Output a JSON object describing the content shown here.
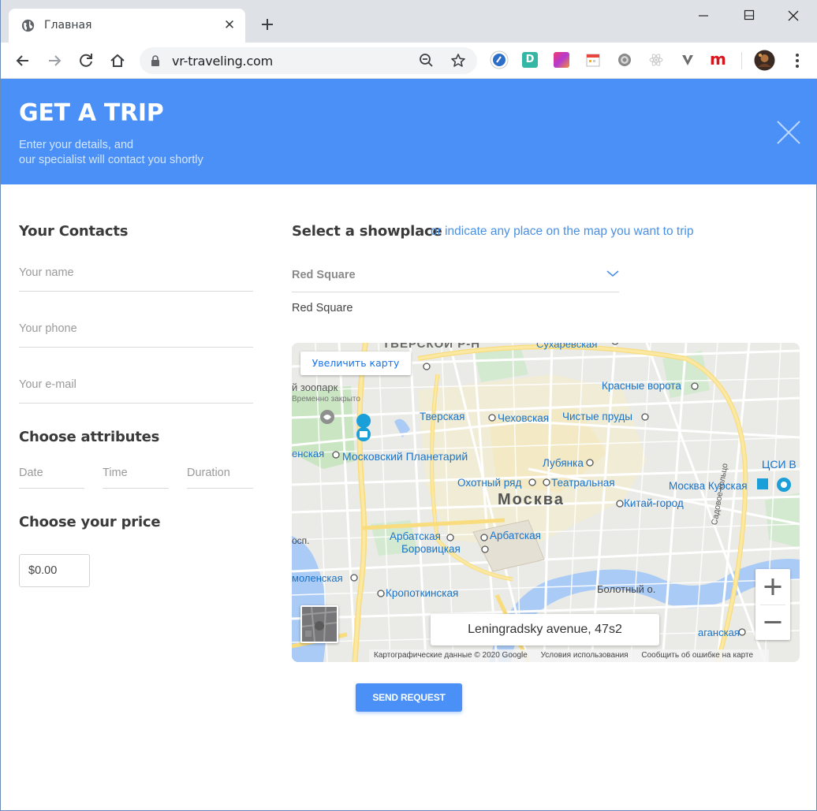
{
  "browser": {
    "tab_title": "Главная",
    "url": "vr-traveling.com",
    "extensions": [
      "blue-circle-extension",
      "d-extension",
      "gradient-extension",
      "calendar-extension",
      "gear-extension",
      "react-extension",
      "v-extension",
      "m-extension"
    ]
  },
  "header": {
    "title": "GET A TRIP",
    "subtitle_line1": "Enter your details, and",
    "subtitle_line2": "our specialist will contact you shortly",
    "bg_color": "#4a90f7"
  },
  "contacts": {
    "heading": "Your Contacts",
    "name_placeholder": "Your name",
    "phone_placeholder": "Your phone",
    "email_placeholder": "Your e-mail"
  },
  "attributes": {
    "heading": "Choose attributes",
    "date_placeholder": "Date",
    "time_placeholder": "Time",
    "duration_placeholder": "Duration"
  },
  "price": {
    "heading": "Choose your price",
    "value": "$0.00"
  },
  "showplace": {
    "heading": "Select a showplace",
    "link_text": "or indicate any place on the map you want to trip",
    "selected_value": "Red Square",
    "selected_text": "Red Square"
  },
  "map": {
    "enlarge_label": "Увеличить карту",
    "address": "Leningradsky avenue, 47s2",
    "city_label": "Москва",
    "footer_data": "Картографические данные © 2020 Google",
    "footer_terms": "Условия использования",
    "footer_report": "Сообщить об ошибке на карте",
    "labels": {
      "tverskoy": "ТВЕРСКОЙ Р-Н",
      "sukharevskaya": "Сухаревская",
      "tverskaya": "Тверская",
      "chekhovskaya": "Чеховская",
      "chistye_prudy": "Чистые пруды",
      "krasnye_vorota": "Красные ворота",
      "zoopark": "й зоопарк",
      "zakryto": "Временно закрыто",
      "planetariy": "Московский Планетарий",
      "lubyanka": "Лубянка",
      "okhotny_ryad": "Охотный ряд",
      "teatralnaya": "Театральная",
      "kursk": "Москва Курская",
      "kitay_gorod": "Китай-город",
      "arbatskaya1": "Арбатская",
      "arbatskaya2": "Арбатская",
      "borovitskaya": "Боровицкая",
      "smolenskaya": "моленская",
      "kropotkinskaya": "Кропоткинская",
      "bolotny": "Болотный о.",
      "taganskaya": "аганская",
      "tsvi": "ЦСИ В",
      "krasnopresnenskaya": "енская",
      "sadovoe": "Садовое кольцо",
      "prosp": "осп."
    }
  },
  "actions": {
    "send_label": "SEND REQUEST"
  }
}
